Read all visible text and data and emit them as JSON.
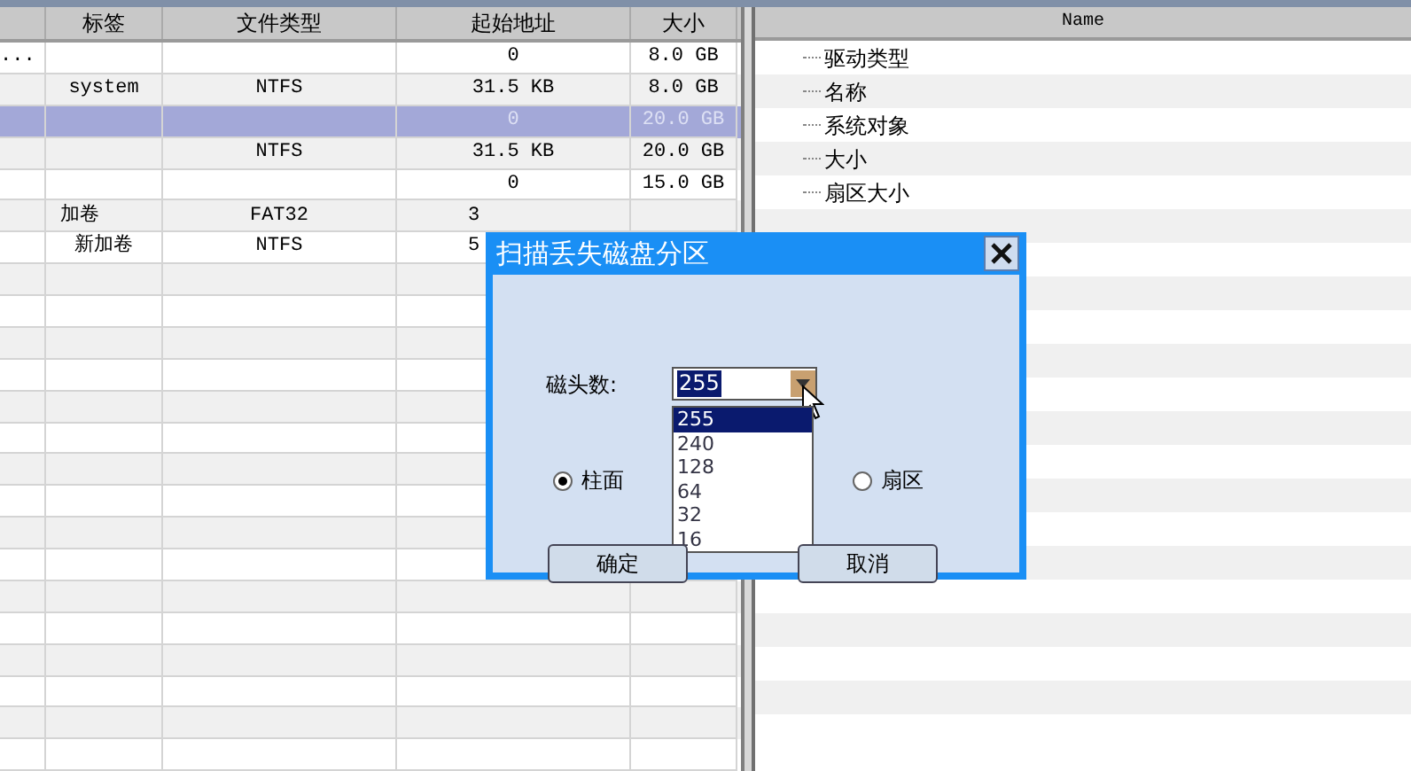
{
  "partition_table": {
    "columns": [
      "标签",
      "文件类型",
      "起始地址",
      "大小"
    ],
    "rows": [
      {
        "column_1": "...",
        "start": "0",
        "size": "8.0 GB",
        "selected": false
      },
      {
        "label": "system",
        "fs": "NTFS",
        "start": "31.5 KB",
        "size": "8.0 GB",
        "selected": false
      },
      {
        "start": "0",
        "size": "20.0 GB",
        "selected": true
      },
      {
        "fs": "NTFS",
        "start": "31.5 KB",
        "size": "20.0 GB",
        "selected": false
      },
      {
        "start": "0",
        "size": "15.0 GB",
        "selected": false
      },
      {
        "label": "加卷",
        "fs": "FAT32",
        "start": "3",
        "selected": false
      },
      {
        "label": "新加卷",
        "fs": "NTFS",
        "start": "5",
        "selected": false
      }
    ]
  },
  "properties_tree": {
    "column": "Name",
    "items": [
      "驱动类型",
      "名称",
      "系统对象",
      "大小",
      "扇区大小"
    ]
  },
  "dialog": {
    "title": "扫描丢失磁盘分区",
    "heads_label": "磁头数:",
    "heads_value": "255",
    "options": [
      {
        "label": "255",
        "selected": true
      },
      {
        "label": "240",
        "selected": false
      },
      {
        "label": "128",
        "selected": false
      },
      {
        "label": "64",
        "selected": false
      },
      {
        "label": "32",
        "selected": false
      },
      {
        "label": "16",
        "selected": false
      }
    ],
    "radios": [
      {
        "label": "柱面",
        "selected": true
      },
      {
        "label": "扇区",
        "selected": false
      }
    ],
    "buttons": [
      "确定",
      "取消"
    ]
  }
}
